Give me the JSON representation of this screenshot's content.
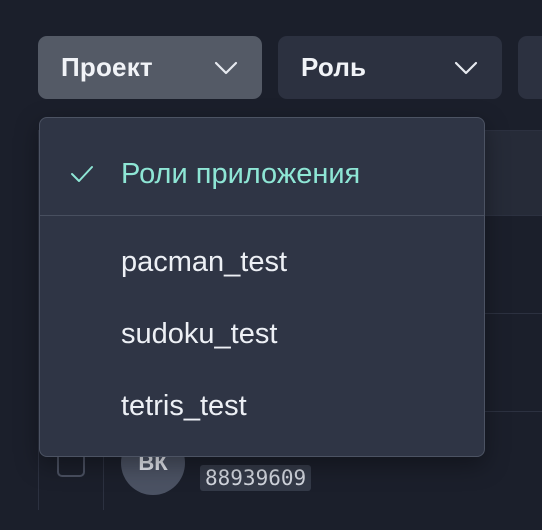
{
  "filters": {
    "project_label": "Проект",
    "role_label": "Роль"
  },
  "dropdown": {
    "selected": {
      "label": "Роли приложения"
    },
    "options": [
      {
        "label": "pacman_test"
      },
      {
        "label": "sudoku_test"
      },
      {
        "label": "tetris_test"
      }
    ]
  },
  "table": {
    "row": {
      "avatar_initials": "ВК",
      "user_id": "88939609"
    }
  },
  "colors": {
    "accent": "#8ee6d5",
    "background": "#1b1f2b",
    "panel": "#2f3545"
  }
}
